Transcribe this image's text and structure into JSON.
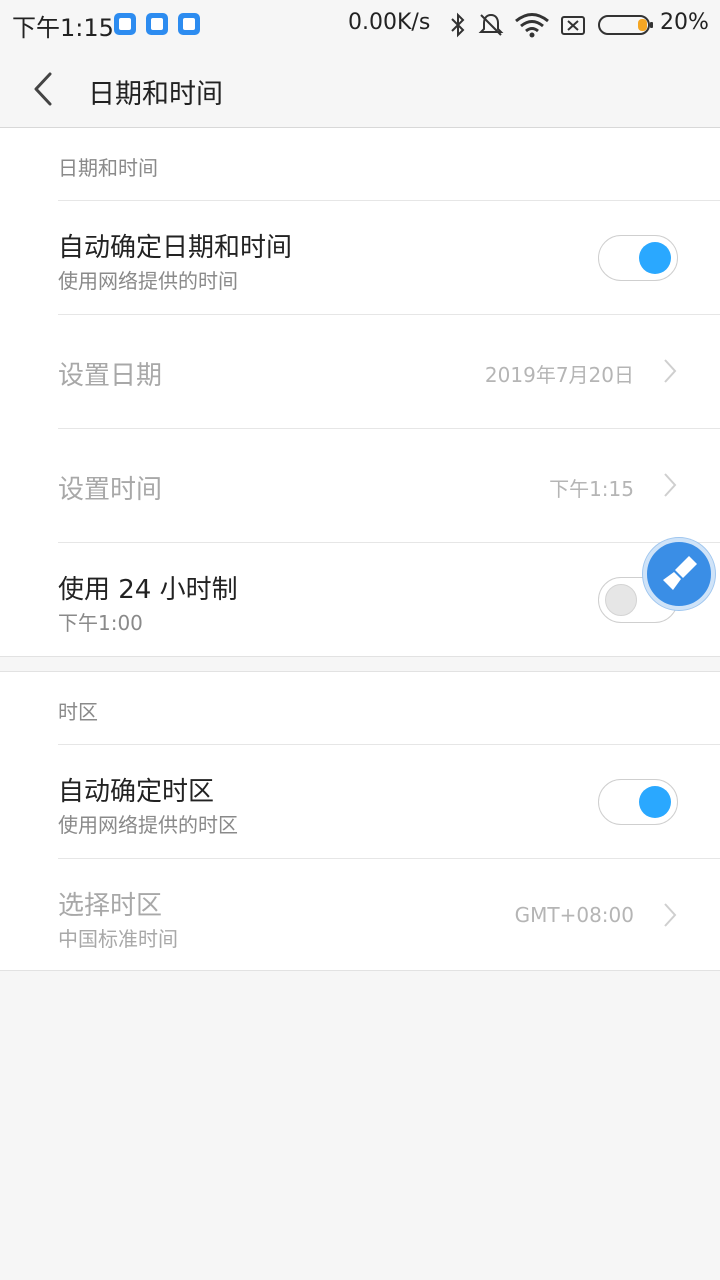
{
  "status_bar": {
    "time": "下午1:15",
    "net_speed": "0.00K/s",
    "battery": "20%"
  },
  "header": {
    "title": "日期和时间"
  },
  "sections": [
    {
      "title": "日期和时间",
      "rows": [
        {
          "title": "自动确定日期和时间",
          "subtitle": "使用网络提供的时间",
          "toggle": "on"
        },
        {
          "title": "设置日期",
          "value": "2019年7月20日"
        },
        {
          "title": "设置时间",
          "value": "下午1:15"
        },
        {
          "title": "使用 24 小时制",
          "subtitle": "下午1:00",
          "toggle": "off"
        }
      ]
    },
    {
      "title": "时区",
      "rows": [
        {
          "title": "自动确定时区",
          "subtitle": "使用网络提供的时区",
          "toggle": "on"
        },
        {
          "title": "选择时区",
          "subtitle": "中国标准时间",
          "value": "GMT+08:00"
        }
      ]
    }
  ],
  "colors": {
    "accent": "#2aa8ff",
    "background": "#f6f6f6"
  }
}
